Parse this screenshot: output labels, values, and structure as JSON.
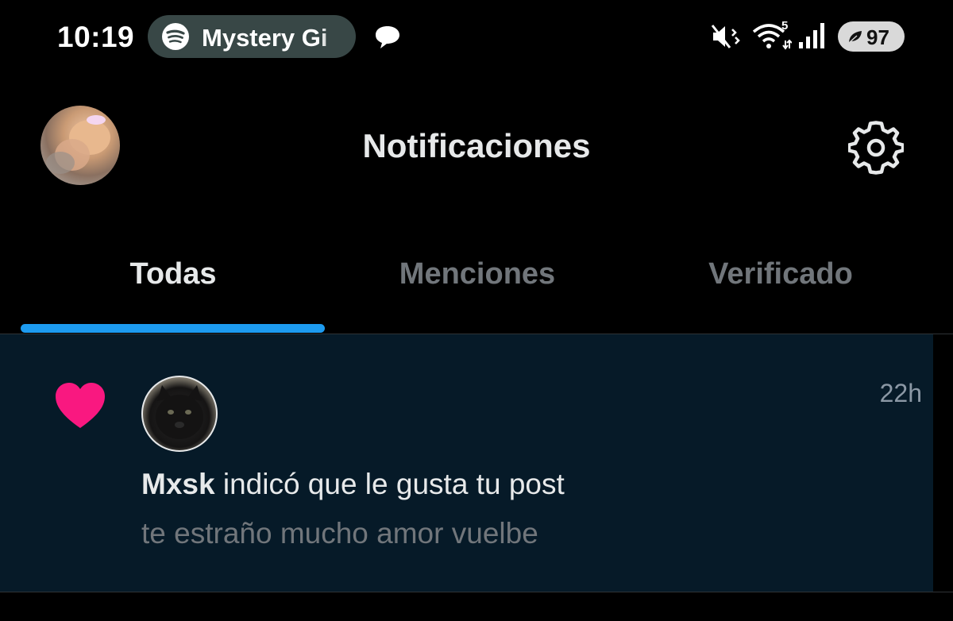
{
  "status_bar": {
    "time": "10:19",
    "media": {
      "app_icon": "spotify-icon",
      "title": "Mystery Gi"
    },
    "notification_icon": "chat-bubble-icon",
    "icons": [
      "mute-icon",
      "wifi-icon",
      "signal-icon"
    ],
    "wifi_badge": "5",
    "battery": {
      "icon": "leaf-icon",
      "level": "97"
    }
  },
  "header": {
    "avatar_icon": "avatar",
    "title": "Notificaciones",
    "settings_icon": "gear-icon"
  },
  "tabs": [
    {
      "label": "Todas",
      "active": true
    },
    {
      "label": "Menciones",
      "active": false
    },
    {
      "label": "Verificado",
      "active": false
    }
  ],
  "notification": {
    "type_icon": "heart-icon",
    "time": "22h",
    "user": "Mxsk",
    "action": " indicó que le gusta tu post",
    "preview": "te estraño mucho amor vuelbe"
  },
  "colors": {
    "background": "#000000",
    "notification_bg": "#061a28",
    "accent": "#1d9bf0",
    "heart": "#f91880",
    "secondary_text": "#71767b"
  }
}
